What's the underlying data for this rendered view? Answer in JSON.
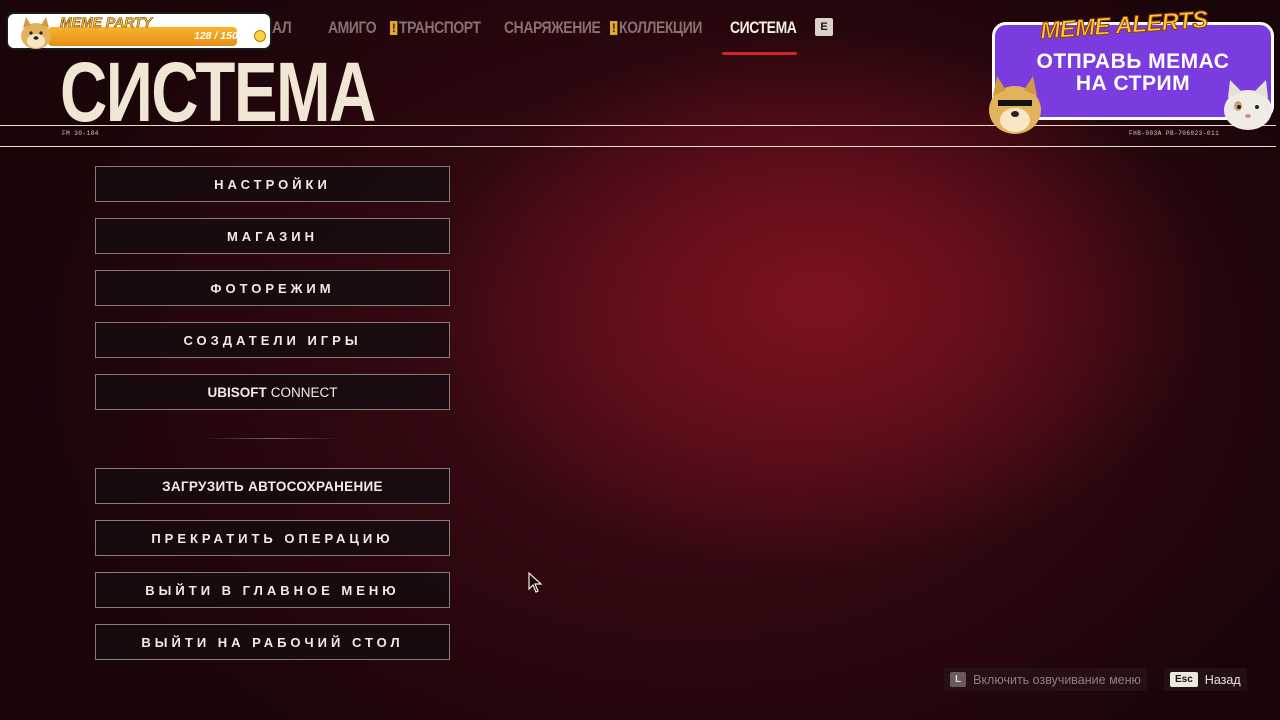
{
  "nav": {
    "tabs": [
      {
        "label": "АЛ",
        "alert": false
      },
      {
        "label": "АМИГО",
        "alert": false
      },
      {
        "label": "ТРАНСПОРТ",
        "alert": true
      },
      {
        "label": "СНАРЯЖЕНИЕ",
        "alert": false
      },
      {
        "label": "КОЛЛЕКЦИИ",
        "alert": true
      },
      {
        "label": "СИСТЕМА",
        "alert": false,
        "active": true
      }
    ],
    "next_key": "E"
  },
  "page": {
    "title": "СИСТЕМА",
    "code_left": "FM 30-184",
    "code_right": "FHB-003A PB-706023-011"
  },
  "menu": {
    "group1": [
      "НАСТРОЙКИ",
      "МАГАЗИН",
      "ФОТОРЕЖИМ",
      "СОЗДАТЕЛИ ИГРЫ"
    ],
    "ubisoft": {
      "brand": "UBISOFT",
      "suffix": "CONNECT"
    },
    "group2": [
      "ЗАГРУЗИТЬ АВТОСОХРАНЕНИЕ",
      "ПРЕКРАТИТЬ ОПЕРАЦИЮ",
      "ВЫЙТИ В ГЛАВНОЕ МЕНЮ",
      "ВЫЙТИ НА РАБОЧИЙ СТОЛ"
    ]
  },
  "footer": {
    "narration": {
      "key": "L",
      "label": "Включить озвучивание меню"
    },
    "back": {
      "key": "Esc",
      "label": "Назад"
    }
  },
  "overlay": {
    "meme_party": {
      "title": "MEME PARTY",
      "count": "128 / 150",
      "progress": 0.853
    },
    "meme_alerts": {
      "title": "MEME ALERTS",
      "line1": "ОТПРАВЬ МЕМАС",
      "line2": "НА СТРИМ"
    }
  },
  "colors": {
    "accent": "#d2222f",
    "alert": "#e3a92d",
    "overlay_purple": "#7b3cdf",
    "bar_orange": "#f8b42a"
  }
}
